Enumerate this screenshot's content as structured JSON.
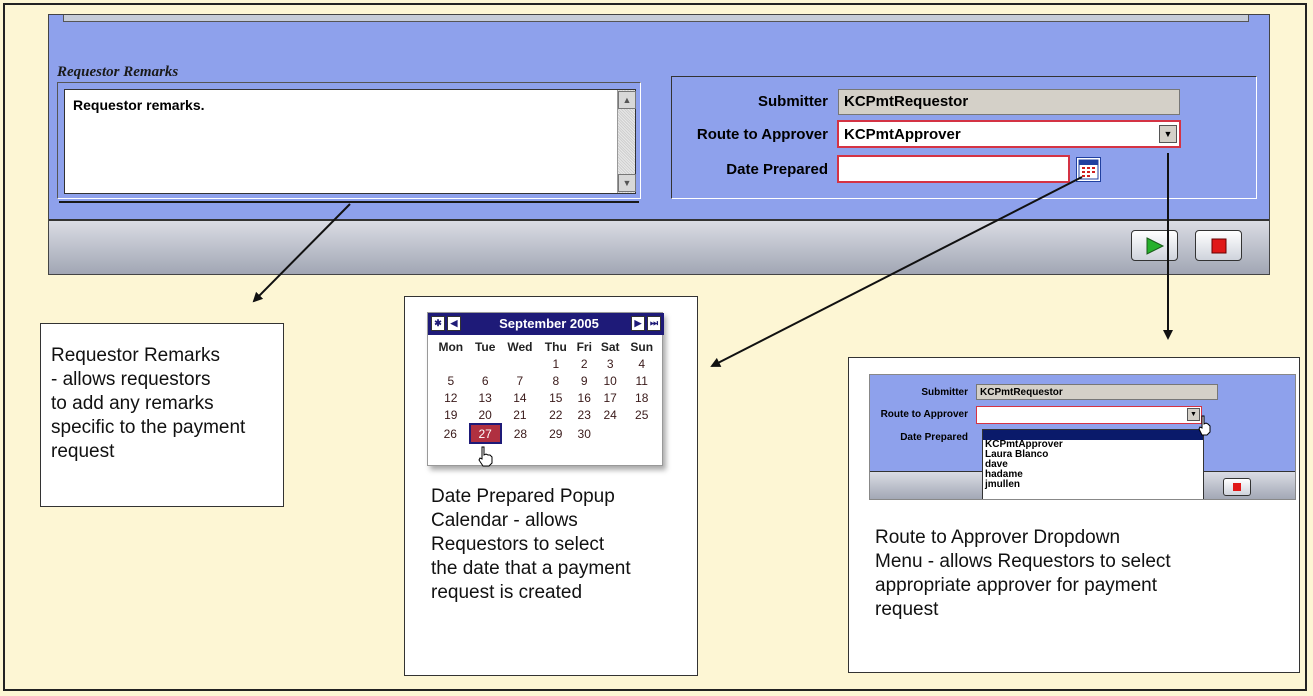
{
  "form": {
    "remarks_section_label": "Requestor Remarks",
    "remarks_text": "Requestor remarks.",
    "submitter_label": "Submitter",
    "submitter_value": "KCPmtRequestor",
    "route_label": "Route to Approver",
    "route_value": "KCPmtApprover",
    "date_label": "Date Prepared",
    "date_value": ""
  },
  "callouts": {
    "remarks": [
      "Requestor Remarks",
      "- allows requestors",
      "to add any remarks",
      "specific to the payment",
      "request"
    ],
    "calendar": [
      "Date Prepared Popup",
      "Calendar - allows",
      "Requestors to select",
      "the date that a payment",
      "request is created"
    ],
    "dropdown": [
      "Route to Approver Dropdown",
      "Menu - allows Requestors to select",
      "appropriate approver for payment",
      "request"
    ]
  },
  "calendar": {
    "title": "September 2005",
    "weekdays": [
      "Mon",
      "Tue",
      "Wed",
      "Thu",
      "Fri",
      "Sat",
      "Sun"
    ],
    "weeks": [
      [
        "",
        "",
        "",
        "1",
        "2",
        "3",
        "4"
      ],
      [
        "5",
        "6",
        "7",
        "8",
        "9",
        "10",
        "11"
      ],
      [
        "12",
        "13",
        "14",
        "15",
        "16",
        "17",
        "18"
      ],
      [
        "19",
        "20",
        "21",
        "22",
        "23",
        "24",
        "25"
      ],
      [
        "26",
        "27",
        "28",
        "29",
        "30",
        "",
        ""
      ]
    ],
    "selected_day": "27"
  },
  "dropdown_demo": {
    "submitter_label": "Submitter",
    "submitter_value": "KCPmtRequestor",
    "route_label": "Route to Approver",
    "date_label": "Date Prepared",
    "options": [
      "",
      "KCPmtApprover",
      "Laura Blanco",
      "dave",
      "hadame",
      "jmullen"
    ]
  },
  "colors": {
    "panel_blue": "#8ea1ec",
    "page_bg": "#fdf6d4",
    "calendar_header": "#1e1a78",
    "required_border": "#d43344",
    "submit_green": "#27b02c",
    "stop_red": "#e01818"
  },
  "icons": [
    "scroll-up-icon",
    "scroll-down-icon",
    "dropdown-arrow-icon",
    "calendar-icon",
    "play-icon",
    "stop-icon",
    "first-month-icon",
    "prev-month-icon",
    "next-month-icon",
    "last-month-icon",
    "hand-cursor-icon"
  ]
}
